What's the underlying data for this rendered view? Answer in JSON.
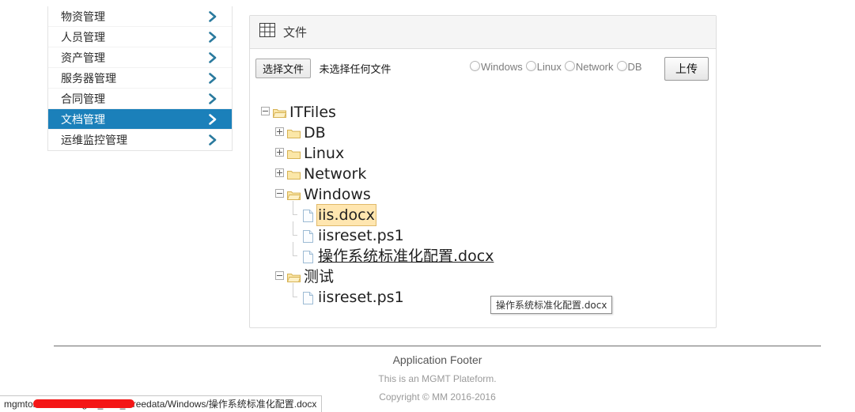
{
  "sidebar": {
    "items": [
      {
        "label": "物资管理",
        "redacted": true,
        "active": false,
        "chevron_icon": "chevron-right-icon"
      },
      {
        "label": "人员管理",
        "redacted": true,
        "active": false,
        "chevron_icon": "chevron-right-icon"
      },
      {
        "label": "资产管理",
        "redacted": true,
        "active": false,
        "chevron_icon": "chevron-right-icon"
      },
      {
        "label": "服务器管理",
        "redacted": true,
        "active": false,
        "chevron_icon": "chevron-right-icon"
      },
      {
        "label": "合同管理",
        "redacted": true,
        "active": false,
        "chevron_icon": "chevron-right-icon"
      },
      {
        "label": "文档管理",
        "redacted": false,
        "active": true,
        "chevron_icon": "chevron-right-icon"
      },
      {
        "label": "运维监控管理",
        "redacted": true,
        "active": false,
        "chevron_icon": "chevron-right-icon"
      }
    ]
  },
  "panel": {
    "icon": "table-grid-icon",
    "title": "文件"
  },
  "toolbar": {
    "file_button_label": "选择文件",
    "file_status_text": "未选择任何文件",
    "radios": [
      {
        "label": "Windows",
        "checked": false
      },
      {
        "label": "Linux",
        "checked": false
      },
      {
        "label": "Network",
        "checked": false
      },
      {
        "label": "DB",
        "checked": false
      }
    ],
    "upload_label": "上传"
  },
  "tree": {
    "nodes": [
      {
        "label": "ITFiles",
        "level": 1,
        "type": "folder",
        "state": "expanded",
        "icon": "folder-open-icon"
      },
      {
        "label": "DB",
        "level": 2,
        "type": "folder",
        "state": "collapsed",
        "icon": "folder-icon"
      },
      {
        "label": "Linux",
        "level": 2,
        "type": "folder",
        "state": "collapsed",
        "icon": "folder-icon"
      },
      {
        "label": "Network",
        "level": 2,
        "type": "folder",
        "state": "collapsed",
        "icon": "folder-icon"
      },
      {
        "label": "Windows",
        "level": 2,
        "type": "folder",
        "state": "expanded",
        "icon": "folder-open-icon"
      },
      {
        "label": "iis.docx",
        "level": 3,
        "type": "file",
        "state": "leaf",
        "icon": "document-icon",
        "highlighted": true
      },
      {
        "label": "iisreset.ps1",
        "level": 3,
        "type": "file",
        "state": "leaf",
        "icon": "document-icon"
      },
      {
        "label": "操作系统标准化配置.docx",
        "level": 3,
        "type": "file",
        "state": "leaf",
        "icon": "document-icon",
        "underlined": true
      },
      {
        "label": "测试",
        "level": 2,
        "type": "folder",
        "state": "expanded",
        "icon": "folder-open-icon"
      },
      {
        "label": "iisreset.ps1",
        "level": 3,
        "type": "file",
        "state": "leaf",
        "icon": "document-icon"
      }
    ]
  },
  "tooltip": {
    "text": "操作系统标准化配置.docx"
  },
  "footer": {
    "title": "Application Footer",
    "subtitle": "This is an MGMT Plateform.",
    "copyright": "Copyright © MM 2016-2016"
  },
  "statusbar": {
    "prefix": "mgmt",
    "url": "om/sinfors/mgmt_files_ztreedata/Windows/操作系统标准化配置.docx"
  },
  "colors": {
    "accent_blue": "#1b80ba",
    "chevron_blue": "#2a7a9e",
    "highlight_peach": "#ffe6b0",
    "redaction_red": "#f41616",
    "folder_yellow": "#f7d98a"
  }
}
